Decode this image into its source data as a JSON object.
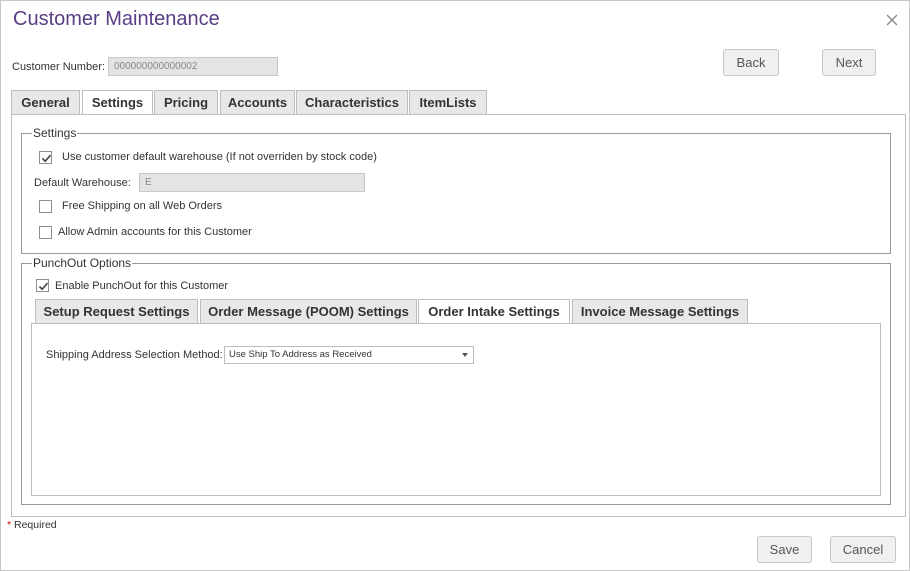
{
  "window": {
    "title": "Customer Maintenance"
  },
  "customer": {
    "number_label": "Customer Number:",
    "number_value": "000000000000002"
  },
  "nav": {
    "back_label": "Back",
    "next_label": "Next"
  },
  "tabs": [
    {
      "label": "General",
      "active": false
    },
    {
      "label": "Settings",
      "active": true
    },
    {
      "label": "Pricing",
      "active": false
    },
    {
      "label": "Accounts",
      "active": false
    },
    {
      "label": "Characteristics",
      "active": false
    },
    {
      "label": "ItemLists",
      "active": false
    }
  ],
  "settings": {
    "legend": "Settings",
    "use_default_warehouse": {
      "label": "Use customer default warehouse (If not overriden by stock code)",
      "checked": true
    },
    "default_warehouse_label": "Default Warehouse:",
    "default_warehouse_value": "E",
    "free_shipping": {
      "label": "Free Shipping on all Web Orders",
      "checked": false
    },
    "allow_admin": {
      "label": "Allow Admin accounts for this Customer",
      "checked": false
    }
  },
  "punchout": {
    "legend": "PunchOut Options",
    "enable": {
      "label": "Enable PunchOut for this Customer",
      "checked": true
    },
    "subtabs": [
      {
        "label": "Setup Request Settings",
        "active": false
      },
      {
        "label": "Order Message (POOM) Settings",
        "active": false
      },
      {
        "label": "Order Intake Settings",
        "active": true
      },
      {
        "label": "Invoice Message Settings",
        "active": false
      }
    ],
    "shipping_method_label": "Shipping Address Selection Method:",
    "shipping_method_value": "Use Ship To Address as Received"
  },
  "footer": {
    "required_star": "*",
    "required_label": " Required",
    "save_label": "Save",
    "cancel_label": "Cancel"
  },
  "colors": {
    "title": "#5a3e85",
    "required_star": "#cc0000",
    "tab_inactive_bg": "#e8e8e8",
    "button_bg": "#f0f0f0"
  },
  "icons": {
    "close": "close-icon",
    "checkmark": "checkmark-icon",
    "dropdown": "chevron-down-icon"
  }
}
